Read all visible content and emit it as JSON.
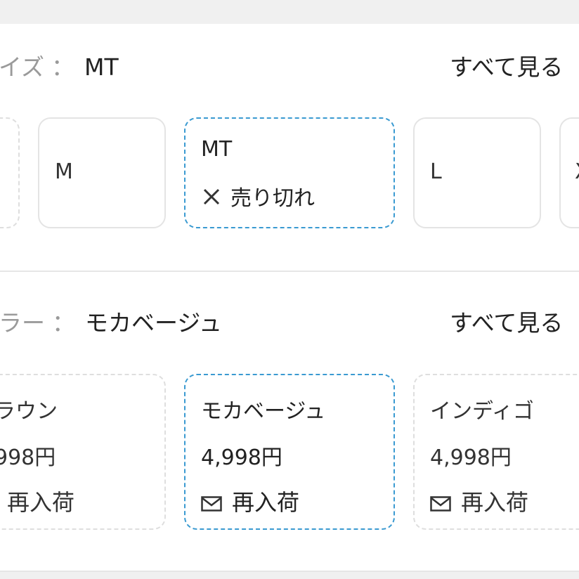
{
  "size_section": {
    "label": "サイズ",
    "label_visible": "イズ",
    "colon": "：",
    "selected_value": "MT",
    "see_all": "すべて見る"
  },
  "size_options": [
    {
      "label": ""
    },
    {
      "label": "M"
    },
    {
      "label": "MT",
      "status": "売り切れ",
      "status_icon": "close-icon",
      "selected": true
    },
    {
      "label": "L"
    },
    {
      "label": "X"
    }
  ],
  "color_section": {
    "label_visible": "ラー",
    "colon": "：",
    "selected_value": "モカベージュ",
    "see_all": "すべて見る"
  },
  "color_options": [
    {
      "name": "ラウン",
      "price": "998円",
      "restock": "再入荷",
      "restock_icon": "mail-icon"
    },
    {
      "name": "モカベージュ",
      "price": "4,998円",
      "restock": "再入荷",
      "restock_icon": "mail-icon",
      "selected": true
    },
    {
      "name": "インディゴ",
      "price": "4,998円",
      "restock": "再入荷",
      "restock_icon": "mail-icon"
    }
  ],
  "colors": {
    "selected_border": "#3a9ad1",
    "chip_border": "#e4e4e4",
    "muted_text": "#9a9a9a"
  }
}
